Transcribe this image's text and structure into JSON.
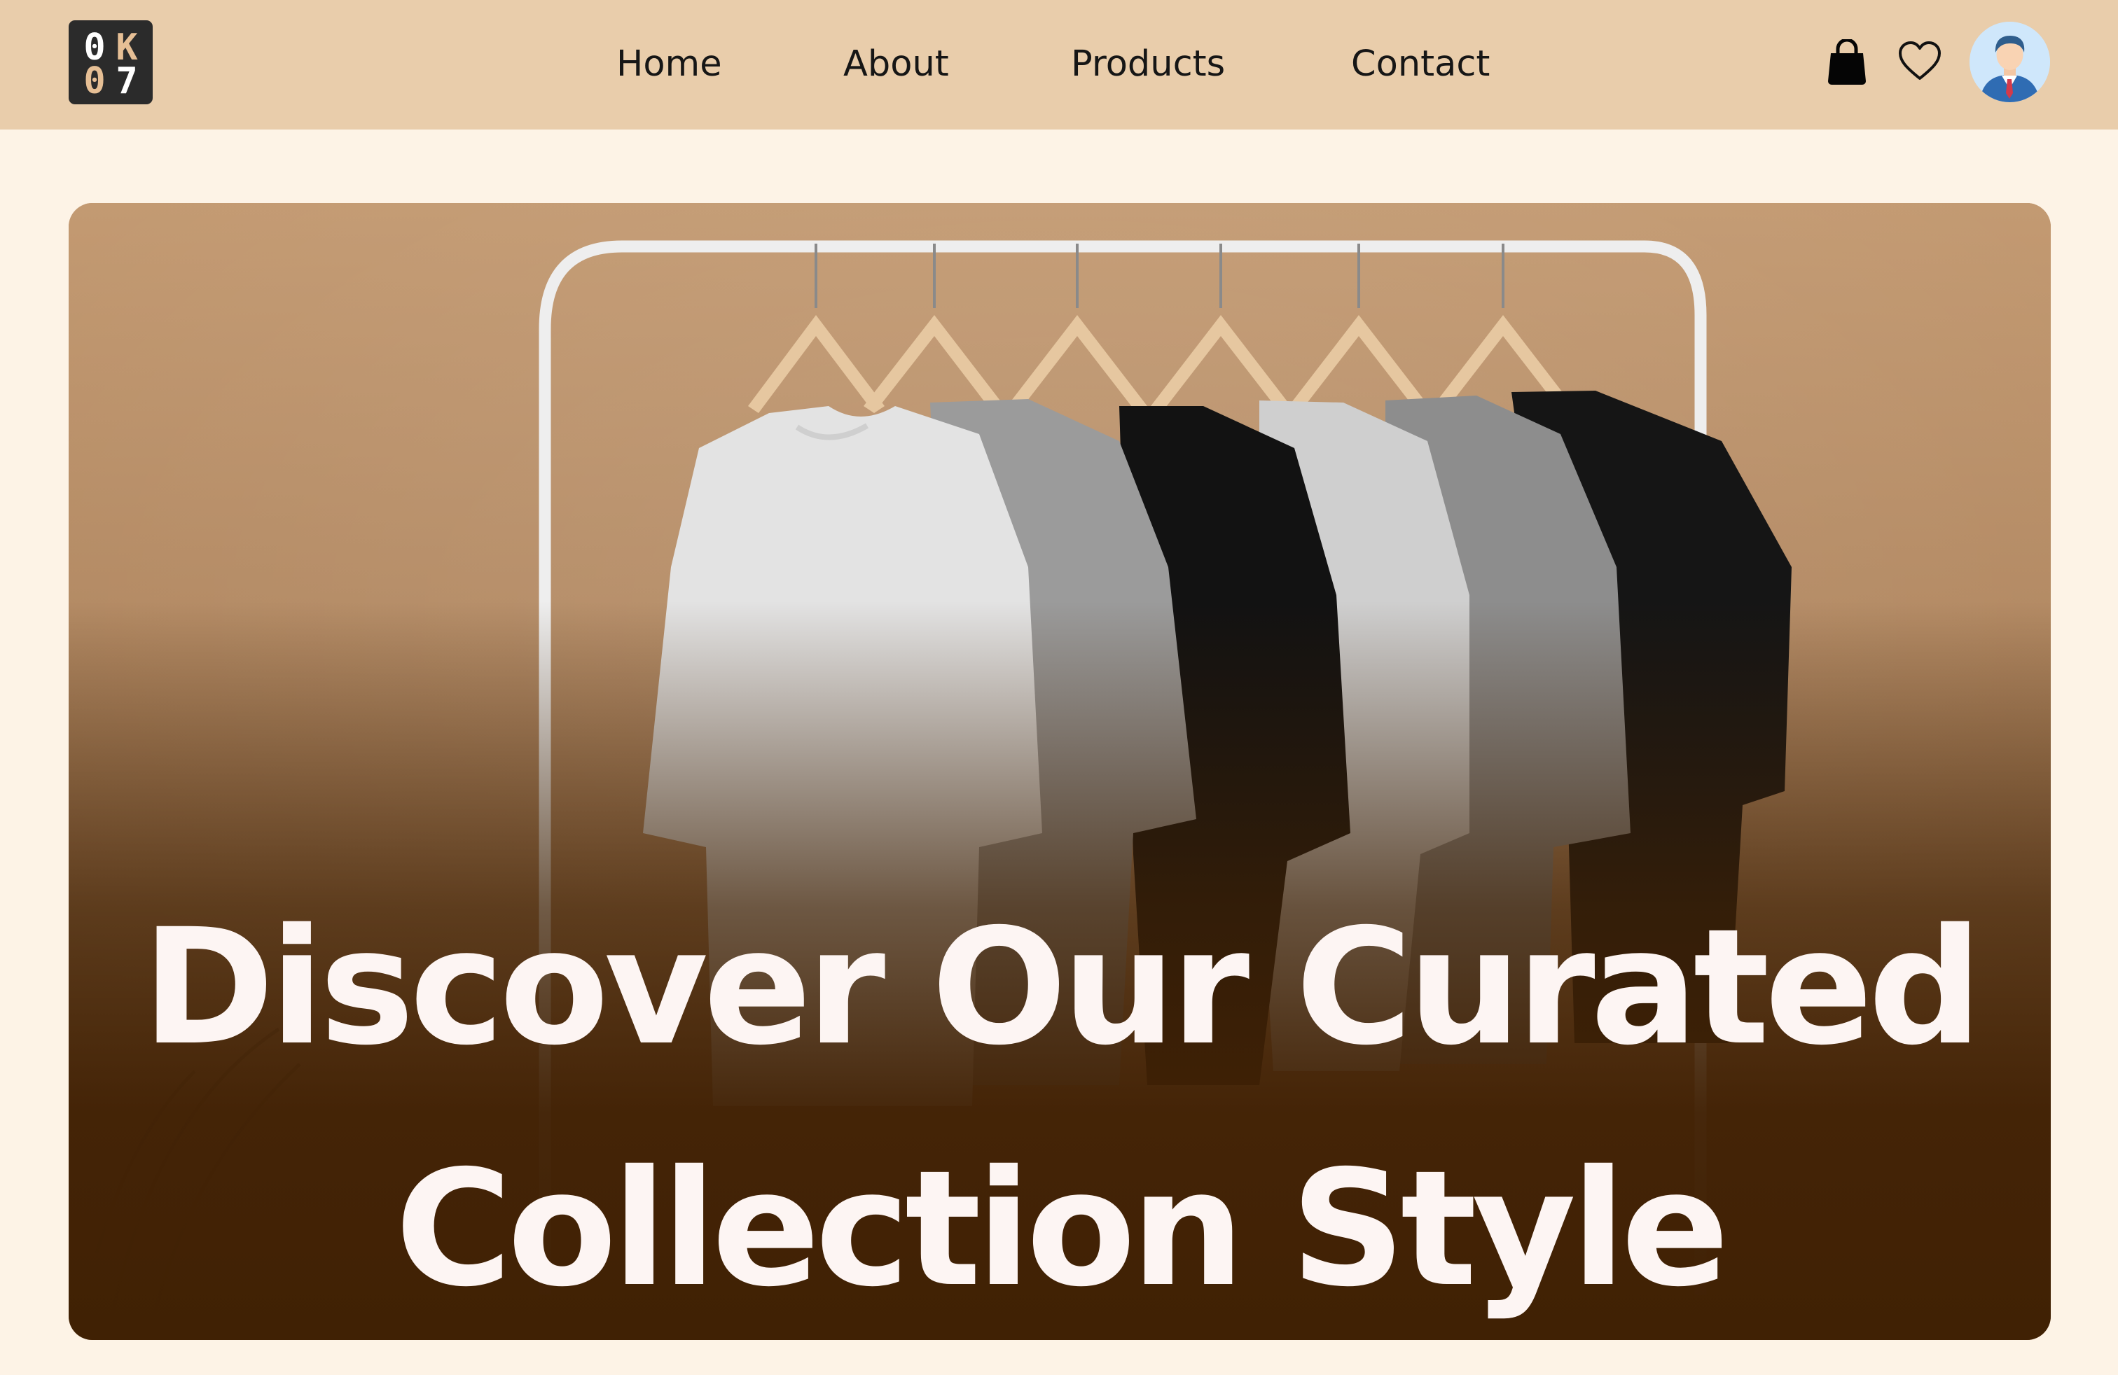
{
  "logo": {
    "chars": [
      "0",
      "K",
      "0",
      "7"
    ]
  },
  "nav": {
    "home": "Home",
    "about": "About",
    "products": "Products",
    "contact": "Contact"
  },
  "icons": [
    "shopping-bag-icon",
    "heart-icon",
    "user-avatar"
  ],
  "hero": {
    "title_line1": "Discover Our Curated",
    "title_line2": "Collection Style"
  },
  "colors": {
    "page_background": "#fdf3e6",
    "header_background": "#e9cdab",
    "hero_text": "#fdf5f3",
    "hero_gradient_bottom": "#402104"
  }
}
